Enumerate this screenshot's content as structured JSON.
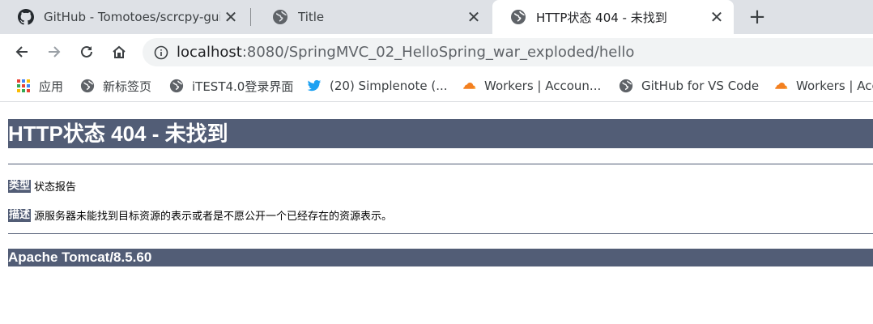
{
  "tabs": [
    {
      "title": "GitHub - Tomotoes/scrcpy-gui",
      "icon": "github-icon"
    },
    {
      "title": "Title",
      "icon": "globe-icon"
    },
    {
      "title": "HTTP状态 404 - 未找到",
      "icon": "globe-icon",
      "active": true
    }
  ],
  "toolbar": {
    "url_host": "localhost",
    "url_rest": ":8080/SpringMVC_02_HelloSpring_war_exploded/hello"
  },
  "bookmarks": [
    {
      "label": "应用",
      "icon": "apps-grid-icon"
    },
    {
      "label": "新标签页",
      "icon": "globe-icon"
    },
    {
      "label": "iTEST4.0登录界面",
      "icon": "globe-icon"
    },
    {
      "label": "(20) Simplenote (...",
      "icon": "twitter-bird-icon"
    },
    {
      "label": "Workers | Accoun...",
      "icon": "cloudflare-icon"
    },
    {
      "label": "GitHub for VS Code",
      "icon": "globe-icon"
    },
    {
      "label": "Workers | Acc",
      "icon": "cloudflare-icon"
    }
  ],
  "page": {
    "heading": "HTTP状态 404 - 未找到",
    "type_label": "类型",
    "type_value": "状态报告",
    "desc_label": "描述",
    "desc_value": "源服务器未能找到目标资源的表示或者是不愿公开一个已经存在的资源表示。",
    "footer": "Apache Tomcat/8.5.60"
  },
  "colors": {
    "tabstrip_bg": "#dee1e6",
    "tomcat_header": "#525d76",
    "twitter_blue": "#1da1f2",
    "cloudflare_orange": "#f38020"
  }
}
